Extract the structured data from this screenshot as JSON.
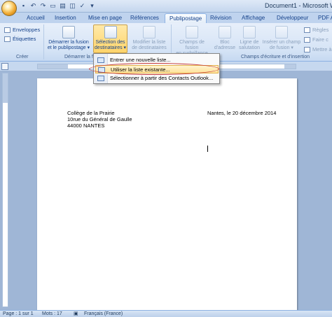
{
  "window": {
    "title": "Document1 - Microsoft Wor"
  },
  "quick_access": [
    "save-icon",
    "undo-icon",
    "redo-icon",
    "open-icon",
    "print-icon",
    "preview-icon",
    "spelling-icon",
    "dropdown-icon"
  ],
  "tabs": [
    "Accueil",
    "Insertion",
    "Mise en page",
    "Références",
    "Publipostage",
    "Révision",
    "Affichage",
    "Développeur",
    "PDF A"
  ],
  "ribbon": {
    "create": {
      "envelopes": "Enveloppes",
      "labels": "Étiquettes",
      "group": "Créer"
    },
    "start": {
      "start_merge_line1": "Démarrer la fusion",
      "start_merge_line2": "et le publipostage",
      "select_recipients_line1": "Sélection des",
      "select_recipients_line2": "destinataires",
      "edit_recipients_line1": "Modifier la liste",
      "edit_recipients_line2": "de destinataires",
      "group": "Démarrer la f"
    },
    "write": {
      "highlight_line1": "Champs de fusion",
      "highlight_line2": "en surbrillance",
      "address_line1": "Bloc",
      "address_line2": "d'adresse",
      "greeting_line1": "Ligne de",
      "greeting_line2": "salutation",
      "insert_field_line1": "Insérer un champ",
      "insert_field_line2": "de fusion",
      "group": "Champs d'écriture et d'insertion",
      "rules": "Règles",
      "match": "Faire c",
      "update": "Mettre à"
    }
  },
  "menu": {
    "items": [
      "Entrer une nouvelle liste...",
      "Utiliser la liste existante...",
      "Sélectionner à partir des Contacts Outlook..."
    ]
  },
  "document": {
    "address_lines": [
      "Collège de la Prairie",
      "10rue du Général de Gaulle",
      "44000 NANTES"
    ],
    "date_line": "Nantes, le 20 décembre 2014"
  },
  "status": {
    "page": "Page : 1 sur 1",
    "words": "Mots : 17",
    "language": "Français (France)"
  },
  "colors": {
    "accent": "#15428b",
    "highlight": "#ffe39a",
    "annotation": "#c43a3a"
  }
}
